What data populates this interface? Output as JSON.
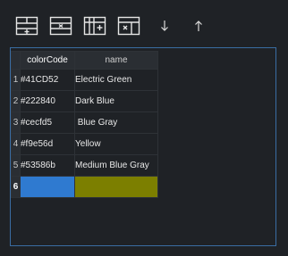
{
  "toolbar": {
    "buttons": [
      {
        "name": "add-row",
        "icon": "table-insert-row-icon"
      },
      {
        "name": "delete-row",
        "icon": "table-delete-row-icon"
      },
      {
        "name": "add-column",
        "icon": "table-insert-column-icon"
      },
      {
        "name": "delete-column",
        "icon": "table-delete-column-icon"
      },
      {
        "name": "move-down",
        "icon": "arrow-down-icon"
      },
      {
        "name": "move-up",
        "icon": "arrow-up-icon"
      }
    ]
  },
  "grid": {
    "columns": [
      "colorCode",
      "name"
    ],
    "rows": [
      {
        "num": "1",
        "colorCode": "#41CD52",
        "name": "Electric Green"
      },
      {
        "num": "2",
        "colorCode": "#222840",
        "name": "Dark Blue"
      },
      {
        "num": "3",
        "colorCode": "#cecfd5",
        "name": " Blue Gray"
      },
      {
        "num": "4",
        "colorCode": "#f9e56d",
        "name": "Yellow"
      },
      {
        "num": "5",
        "colorCode": "#53586b",
        "name": "Medium Blue Gray"
      }
    ],
    "new_row": {
      "num": "6"
    }
  },
  "colors": {
    "background": "#1f2226",
    "panel_border": "#3a6da3",
    "new_row_color_cell": "#2f7ad0",
    "new_row_name_cell": "#7c7f00"
  }
}
